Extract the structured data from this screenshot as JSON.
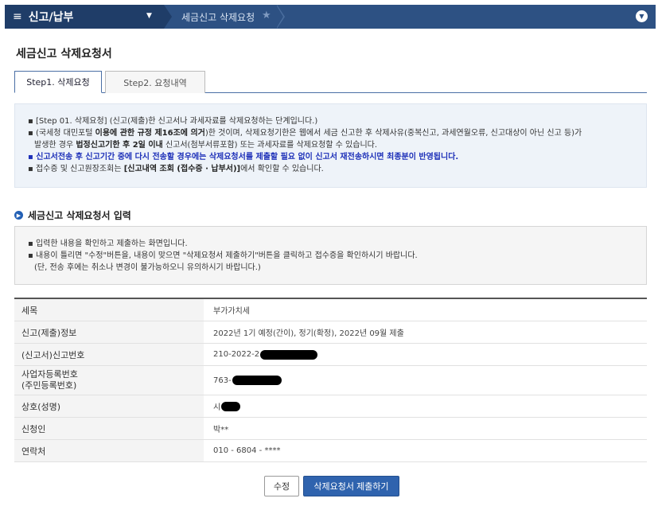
{
  "topbar": {
    "menu_title": "신고/납부",
    "breadcrumb": "세금신고 삭제요청",
    "icons": {
      "menu": "hamburger-icon",
      "caret": "caret-down-icon",
      "favorite": "star-icon",
      "toggle": "chevron-down-icon"
    }
  },
  "page": {
    "title": "세금신고 삭제요청서"
  },
  "tabs": [
    {
      "label": "Step1. 삭제요청",
      "active": true
    },
    {
      "label": "Step2. 요청내역",
      "active": false
    }
  ],
  "notice": {
    "line1": "▪ [Step 01. 삭제요청] (신고(제출)한 신고서나 과세자료를 삭제요청하는 단계입니다.)",
    "line2_pre": "▪ (국세청 대민포털 ",
    "line2_bold": "이용에 관한 규정 제16조에 의거",
    "line2_post": ")한 것이며, 삭제요청기한은 웹에서 세금 신고한 후 삭제사유(중복신고, 과세연월오류, 신고대상이 아닌 신고 등)가",
    "line3_pre": "발생한 경우 ",
    "line3_bold": "법정신고기한 후 2일 이내",
    "line3_post": " 신고서(첨부서류포함) 또는 과세자료를 삭제요청할 수 있습니다.",
    "line4": "▪ 신고서전송 후 신고기간 중에 다시 전송할 경우에는 삭제요청서를 제출할 필요 없이 신고서 재전송하시면 최종분이 반영됩니다.",
    "line5_pre": "▪ 접수증 및 신고원장조회는 ",
    "line5_bold": "[신고내역 조회 (접수증 · 납부서)]",
    "line5_post": "에서 확인할 수 있습니다."
  },
  "section": {
    "title": "세금신고 삭제요청서 입력",
    "icon": "circle-arrow-icon"
  },
  "guide": {
    "line1": "▪ 입력한 내용을 확인하고 제출하는 화면입니다.",
    "line2": "▪ 내용이 틀리면 \"수정\"버튼을, 내용이 맞으면 \"삭제요청서 제출하기\"버튼을 클릭하고 접수증을 확인하시기 바랍니다.",
    "line3": "(단, 전송 후에는 취소나 변경이 불가능하오니 유의하시기 바랍니다.)"
  },
  "table": {
    "tax_item": {
      "label": "세목",
      "value": "부가가치세"
    },
    "report_info": {
      "label": "신고(제출)정보",
      "value": "2022년 1기 예정(간이), 정기(확정), 2022년 09월 제출"
    },
    "report_no": {
      "label": "(신고서)신고번호",
      "value": "210-2022-2"
    },
    "biz_no": {
      "label_line1": "사업자등록번호",
      "label_line2": "(주민등록번호)",
      "value": "763-"
    },
    "company": {
      "label": "상호(성명)",
      "value": "시"
    },
    "applicant": {
      "label": "신청인",
      "value": "박**"
    },
    "contact": {
      "label": "연락처",
      "value": "010  -  6804  -  ****"
    }
  },
  "buttons": {
    "edit": "수정",
    "submit": "삭제요청서 제출하기"
  }
}
